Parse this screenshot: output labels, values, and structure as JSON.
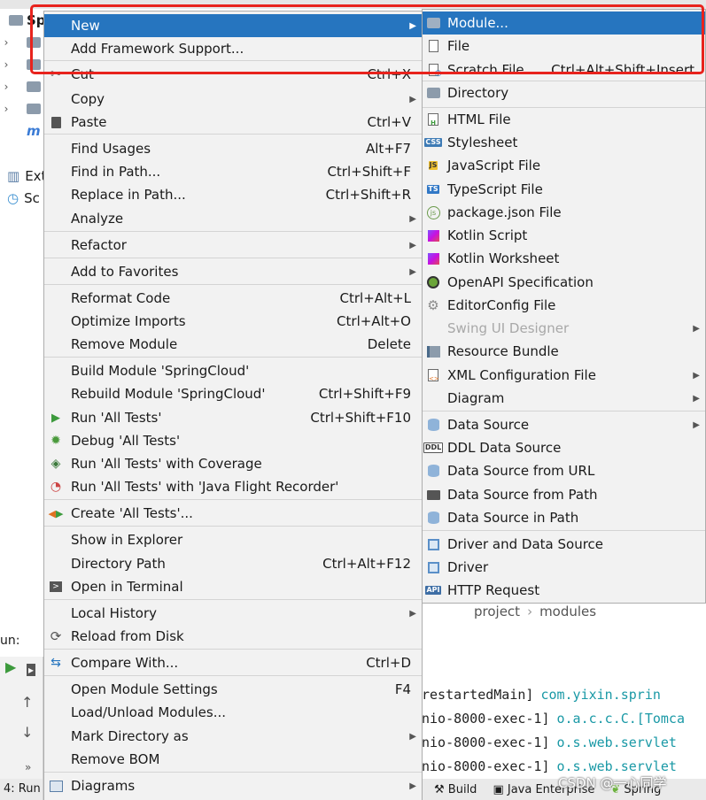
{
  "background": {
    "project_label": "Sp",
    "tree_items": [
      "Ext",
      "Sc"
    ],
    "run_label": "un:",
    "bottom_left_tab": "4: Run",
    "console_lines": [
      {
        "thread": "restartedMain]",
        "logger": "com.yixin.sprin"
      },
      {
        "thread": "nio-8000-exec-1]",
        "logger": "o.a.c.c.C.[Tomca"
      },
      {
        "thread": "nio-8000-exec-1]",
        "logger": "o.s.web.servlet"
      },
      {
        "thread": "nio-8000-exec-1]",
        "logger": "o.s.web.servlet"
      }
    ],
    "bottom_tabs": [
      "Build",
      "Java Enterprise",
      "Spring"
    ],
    "watermark": "CSDN @一心同学"
  },
  "context_menu": {
    "items": [
      {
        "label": "New",
        "shortcut": "",
        "submenu": true,
        "icon": "",
        "selected": true
      },
      {
        "label": "Add Framework Support...",
        "shortcut": "",
        "submenu": false,
        "icon": ""
      },
      {
        "label": "Cut",
        "shortcut": "Ctrl+X",
        "submenu": false,
        "icon": "scissors-icon"
      },
      {
        "label": "Copy",
        "shortcut": "",
        "submenu": true,
        "icon": ""
      },
      {
        "label": "Paste",
        "shortcut": "Ctrl+V",
        "submenu": false,
        "icon": "clipboard-icon"
      },
      {
        "label": "Find Usages",
        "shortcut": "Alt+F7",
        "submenu": false,
        "icon": ""
      },
      {
        "label": "Find in Path...",
        "shortcut": "Ctrl+Shift+F",
        "submenu": false,
        "icon": ""
      },
      {
        "label": "Replace in Path...",
        "shortcut": "Ctrl+Shift+R",
        "submenu": false,
        "icon": ""
      },
      {
        "label": "Analyze",
        "shortcut": "",
        "submenu": true,
        "icon": ""
      },
      {
        "label": "Refactor",
        "shortcut": "",
        "submenu": true,
        "icon": ""
      },
      {
        "label": "Add to Favorites",
        "shortcut": "",
        "submenu": true,
        "icon": ""
      },
      {
        "label": "Reformat Code",
        "shortcut": "Ctrl+Alt+L",
        "submenu": false,
        "icon": ""
      },
      {
        "label": "Optimize Imports",
        "shortcut": "Ctrl+Alt+O",
        "submenu": false,
        "icon": ""
      },
      {
        "label": "Remove Module",
        "shortcut": "Delete",
        "submenu": false,
        "icon": ""
      },
      {
        "label": "Build Module 'SpringCloud'",
        "shortcut": "",
        "submenu": false,
        "icon": ""
      },
      {
        "label": "Rebuild Module 'SpringCloud'",
        "shortcut": "Ctrl+Shift+F9",
        "submenu": false,
        "icon": ""
      },
      {
        "label": "Run 'All Tests'",
        "shortcut": "Ctrl+Shift+F10",
        "submenu": false,
        "icon": "run-icon"
      },
      {
        "label": "Debug 'All Tests'",
        "shortcut": "",
        "submenu": false,
        "icon": "debug-icon"
      },
      {
        "label": "Run 'All Tests' with Coverage",
        "shortcut": "",
        "submenu": false,
        "icon": "coverage-icon"
      },
      {
        "label": "Run 'All Tests' with 'Java Flight Recorder'",
        "shortcut": "",
        "submenu": false,
        "icon": "profiler-icon"
      },
      {
        "label": "Create 'All Tests'...",
        "shortcut": "",
        "submenu": false,
        "icon": "create-test-icon"
      },
      {
        "label": "Show in Explorer",
        "shortcut": "",
        "submenu": false,
        "icon": ""
      },
      {
        "label": "Directory Path",
        "shortcut": "Ctrl+Alt+F12",
        "submenu": false,
        "icon": ""
      },
      {
        "label": "Open in Terminal",
        "shortcut": "",
        "submenu": false,
        "icon": "terminal-icon"
      },
      {
        "label": "Local History",
        "shortcut": "",
        "submenu": true,
        "icon": ""
      },
      {
        "label": "Reload from Disk",
        "shortcut": "",
        "submenu": false,
        "icon": "reload-icon"
      },
      {
        "label": "Compare With...",
        "shortcut": "Ctrl+D",
        "submenu": false,
        "icon": "compare-icon"
      },
      {
        "label": "Open Module Settings",
        "shortcut": "F4",
        "submenu": false,
        "icon": ""
      },
      {
        "label": "Load/Unload Modules...",
        "shortcut": "",
        "submenu": false,
        "icon": ""
      },
      {
        "label": "Mark Directory as",
        "shortcut": "",
        "submenu": true,
        "icon": ""
      },
      {
        "label": "Remove BOM",
        "shortcut": "",
        "submenu": false,
        "icon": ""
      },
      {
        "label": "Diagrams",
        "shortcut": "",
        "submenu": true,
        "icon": "diagrams-icon"
      }
    ]
  },
  "new_submenu": {
    "items": [
      {
        "label": "Module...",
        "shortcut": "",
        "submenu": false,
        "icon": "module-icon",
        "selected": true
      },
      {
        "label": "File",
        "shortcut": "",
        "submenu": false,
        "icon": "file-icon"
      },
      {
        "label": "Scratch File",
        "shortcut": "Ctrl+Alt+Shift+Insert",
        "submenu": false,
        "icon": "scratch-file-icon"
      },
      {
        "label": "Directory",
        "shortcut": "",
        "submenu": false,
        "icon": "folder-icon"
      },
      {
        "label": "HTML File",
        "shortcut": "",
        "submenu": false,
        "icon": "html-file-icon"
      },
      {
        "label": "Stylesheet",
        "shortcut": "",
        "submenu": false,
        "icon": "css-file-icon"
      },
      {
        "label": "JavaScript File",
        "shortcut": "",
        "submenu": false,
        "icon": "js-file-icon"
      },
      {
        "label": "TypeScript File",
        "shortcut": "",
        "submenu": false,
        "icon": "ts-file-icon"
      },
      {
        "label": "package.json File",
        "shortcut": "",
        "submenu": false,
        "icon": "nodejs-icon"
      },
      {
        "label": "Kotlin Script",
        "shortcut": "",
        "submenu": false,
        "icon": "kotlin-script-icon"
      },
      {
        "label": "Kotlin Worksheet",
        "shortcut": "",
        "submenu": false,
        "icon": "kotlin-worksheet-icon"
      },
      {
        "label": "OpenAPI Specification",
        "shortcut": "",
        "submenu": false,
        "icon": "openapi-icon"
      },
      {
        "label": "EditorConfig File",
        "shortcut": "",
        "submenu": false,
        "icon": "gear-icon"
      },
      {
        "label": "Swing UI Designer",
        "shortcut": "",
        "submenu": true,
        "icon": "",
        "disabled": true
      },
      {
        "label": "Resource Bundle",
        "shortcut": "",
        "submenu": false,
        "icon": "resource-bundle-icon"
      },
      {
        "label": "XML Configuration File",
        "shortcut": "",
        "submenu": true,
        "icon": "xml-file-icon"
      },
      {
        "label": "Diagram",
        "shortcut": "",
        "submenu": true,
        "icon": ""
      },
      {
        "label": "Data Source",
        "shortcut": "",
        "submenu": true,
        "icon": "database-icon"
      },
      {
        "label": "DDL Data Source",
        "shortcut": "",
        "submenu": false,
        "icon": "ddl-icon"
      },
      {
        "label": "Data Source from URL",
        "shortcut": "",
        "submenu": false,
        "icon": "database-url-icon"
      },
      {
        "label": "Data Source from Path",
        "shortcut": "",
        "submenu": false,
        "icon": "folder-open-icon"
      },
      {
        "label": "Data Source in Path",
        "shortcut": "",
        "submenu": false,
        "icon": "database-icon"
      },
      {
        "label": "Driver and Data Source",
        "shortcut": "",
        "submenu": false,
        "icon": "driver-icon"
      },
      {
        "label": "Driver",
        "shortcut": "",
        "submenu": false,
        "icon": "driver-icon"
      },
      {
        "label": "HTTP Request",
        "shortcut": "",
        "submenu": false,
        "icon": "api-icon"
      }
    ],
    "breadcrumb": [
      "project",
      "modules"
    ]
  },
  "colors": {
    "selection": "#2675bf",
    "highlight_box": "#e8231d",
    "menu_bg": "#f2f2f2",
    "logger_text": "#1a99a6"
  }
}
